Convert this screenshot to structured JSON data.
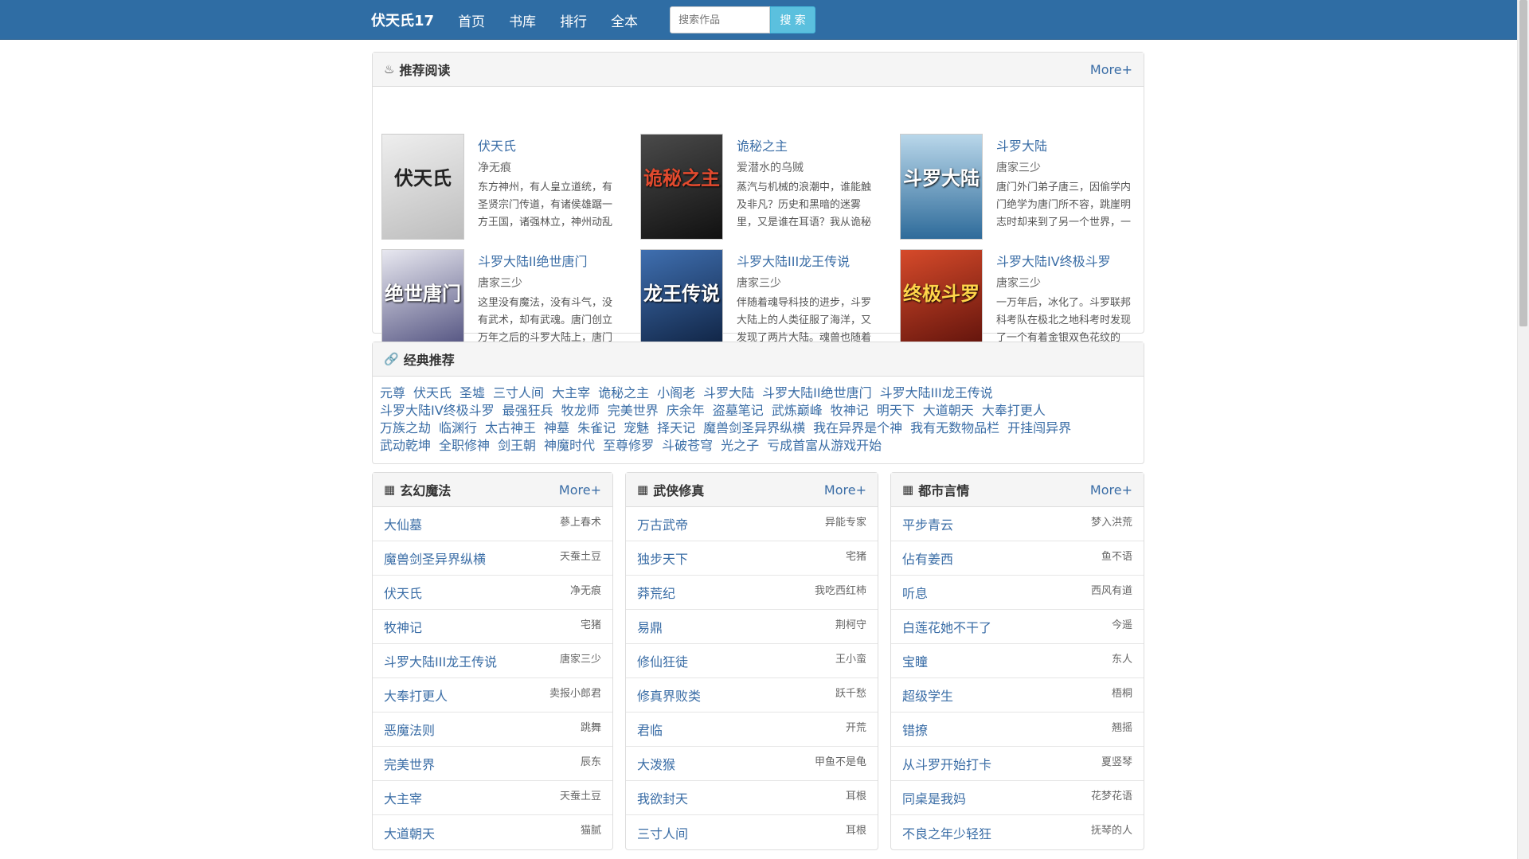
{
  "nav": {
    "brand": "伏天氏17",
    "links": [
      "首页",
      "书库",
      "排行",
      "全本"
    ],
    "search_placeholder": "搜索作品",
    "search_button": "搜 索"
  },
  "recommend": {
    "title": "推荐阅读",
    "more": "More+",
    "books": [
      {
        "title": "伏天氏",
        "author": "净无痕",
        "desc": "东方神州，有人皇立道统，有圣贤宗门传道，有诸侯雄踞一方王国，诸强林立，神州动乱",
        "cover_text": "伏天氏",
        "cover_color": "#d9d9d9"
      },
      {
        "title": "诡秘之主",
        "author": "爱潜水的乌贼",
        "desc": "蒸汽与机械的浪潮中，谁能触及非凡？历史和黑暗的迷雾里，又是谁在耳语？我从诡秘",
        "cover_text": "诡秘之主",
        "cover_color": "#2b2b2b"
      },
      {
        "title": "斗罗大陆",
        "author": "唐家三少",
        "desc": "唐门外门弟子唐三，因偷学内门绝学为唐门所不容，跳崖明志时却来到了另一个世界，一",
        "cover_text": "斗罗大陆",
        "cover_color": "#5d8fb5"
      },
      {
        "title": "斗罗大陆II绝世唐门",
        "author": "唐家三少",
        "desc": "这里没有魔法，没有斗气，没有武术，却有武魂。唐门创立万年之后的斗罗大陆上，唐门",
        "cover_text": "绝世唐门",
        "cover_color": "#6b6b8a"
      },
      {
        "title": "斗罗大陆III龙王传说",
        "author": "唐家三少",
        "desc": "伴随着魂导科技的进步，斗罗大陆上的人类征服了海洋，又发现了两片大陆。魂兽也随着",
        "cover_text": "龙王传说",
        "cover_color": "#2d4a7a"
      },
      {
        "title": "斗罗大陆IV终极斗罗",
        "author": "唐家三少",
        "desc": "一万年后，冰化了。斗罗联邦科考队在极北之地科考时发现了一个有着金银双色花纹的",
        "cover_text": "终极斗罗",
        "cover_color": "#a32a1e"
      }
    ]
  },
  "classic": {
    "title": "经典推荐",
    "lines": [
      [
        "元尊",
        "伏天氏",
        "圣墟",
        "三寸人间",
        "大主宰",
        "诡秘之主",
        "小阁老",
        "斗罗大陆",
        "斗罗大陆II绝世唐门",
        "斗罗大陆III龙王传说"
      ],
      [
        "斗罗大陆IV终极斗罗",
        "最强狂兵",
        "牧龙师",
        "完美世界",
        "庆余年",
        "盗墓笔记",
        "武炼巅峰",
        "牧神记",
        "明天下",
        "大道朝天",
        "大奉打更人"
      ],
      [
        "万族之劫",
        "临渊行",
        "太古神王",
        "神墓",
        "朱雀记",
        "宠魅",
        "择天记",
        "魔兽剑圣异界纵横",
        "我在异界是个神",
        "我有无数物品栏",
        "开挂闯异界"
      ],
      [
        "武动乾坤",
        "全职修神",
        "剑王朝",
        "神魔时代",
        "至尊修罗",
        "斗破苍穹",
        "光之子",
        "亏成首富从游戏开始"
      ]
    ]
  },
  "categories": [
    {
      "title": "玄幻魔法",
      "more": "More+",
      "items": [
        {
          "title": "大仙墓",
          "author": "蔘上春术"
        },
        {
          "title": "魔兽剑圣异界纵横",
          "author": "天蚕土豆"
        },
        {
          "title": "伏天氏",
          "author": "净无痕"
        },
        {
          "title": "牧神记",
          "author": "宅猪"
        },
        {
          "title": "斗罗大陆III龙王传说",
          "author": "唐家三少"
        },
        {
          "title": "大奉打更人",
          "author": "卖报小郎君"
        },
        {
          "title": "恶魔法则",
          "author": "跳舞"
        },
        {
          "title": "完美世界",
          "author": "辰东"
        },
        {
          "title": "大主宰",
          "author": "天蚕土豆"
        },
        {
          "title": "大道朝天",
          "author": "猫腻"
        }
      ]
    },
    {
      "title": "武侠修真",
      "more": "More+",
      "items": [
        {
          "title": "万古武帝",
          "author": "异能专家"
        },
        {
          "title": "独步天下",
          "author": "宅猪"
        },
        {
          "title": "莽荒纪",
          "author": "我吃西红柿"
        },
        {
          "title": "易鼎",
          "author": "荆柯守"
        },
        {
          "title": "修仙狂徒",
          "author": "王小蛮"
        },
        {
          "title": "修真界败类",
          "author": "跃千愁"
        },
        {
          "title": "君临",
          "author": "开荒"
        },
        {
          "title": "大泼猴",
          "author": "甲鱼不是龟"
        },
        {
          "title": "我欲封天",
          "author": "耳根"
        },
        {
          "title": "三寸人间",
          "author": "耳根"
        }
      ]
    },
    {
      "title": "都市言情",
      "more": "More+",
      "items": [
        {
          "title": "平步青云",
          "author": "梦入洪荒"
        },
        {
          "title": "佔有姜西",
          "author": "鱼不语"
        },
        {
          "title": "听息",
          "author": "西风有道"
        },
        {
          "title": "白莲花她不干了",
          "author": "今遥"
        },
        {
          "title": "宝瞳",
          "author": "东人"
        },
        {
          "title": "超级学生",
          "author": "梧桐"
        },
        {
          "title": "错撩",
          "author": "翘摇"
        },
        {
          "title": "从斗罗开始打卡",
          "author": "夏竖琴"
        },
        {
          "title": "同桌是我妈",
          "author": "花梦花语"
        },
        {
          "title": "不良之年少轻狂",
          "author": "抚琴的人"
        }
      ]
    }
  ]
}
